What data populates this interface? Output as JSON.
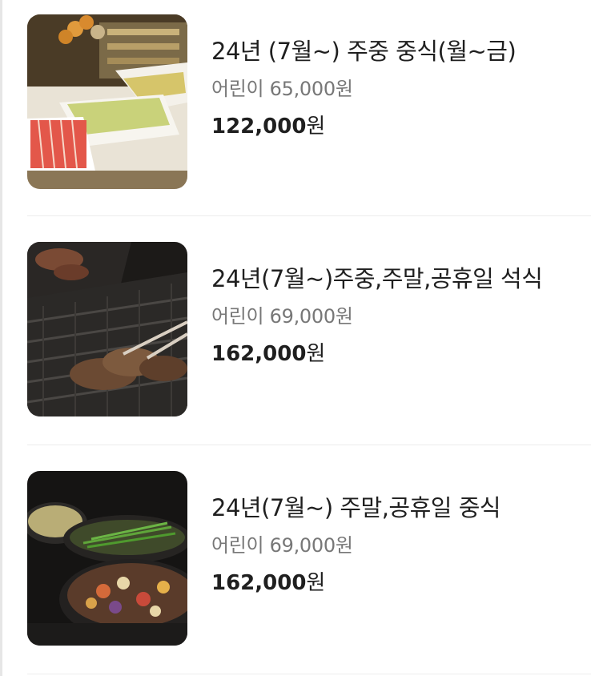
{
  "menu_items": [
    {
      "title": "24년 (7월~) 주중 중식(월~금)",
      "child_price": "어린이 65,000원",
      "price_number": "122,000",
      "price_unit": "원",
      "image": "fruit-buffet-photo"
    },
    {
      "title": "24년(7월~)주중,주말,공휴일 석식",
      "child_price": "어린이 69,000원",
      "price_number": "162,000",
      "price_unit": "원",
      "image": "grilled-lamb-chops-photo"
    },
    {
      "title": "24년(7월~) 주말,공휴일 중식",
      "child_price": "어린이 69,000원",
      "price_number": "162,000",
      "price_unit": "원",
      "image": "sauteed-vegetables-pans-photo"
    }
  ]
}
